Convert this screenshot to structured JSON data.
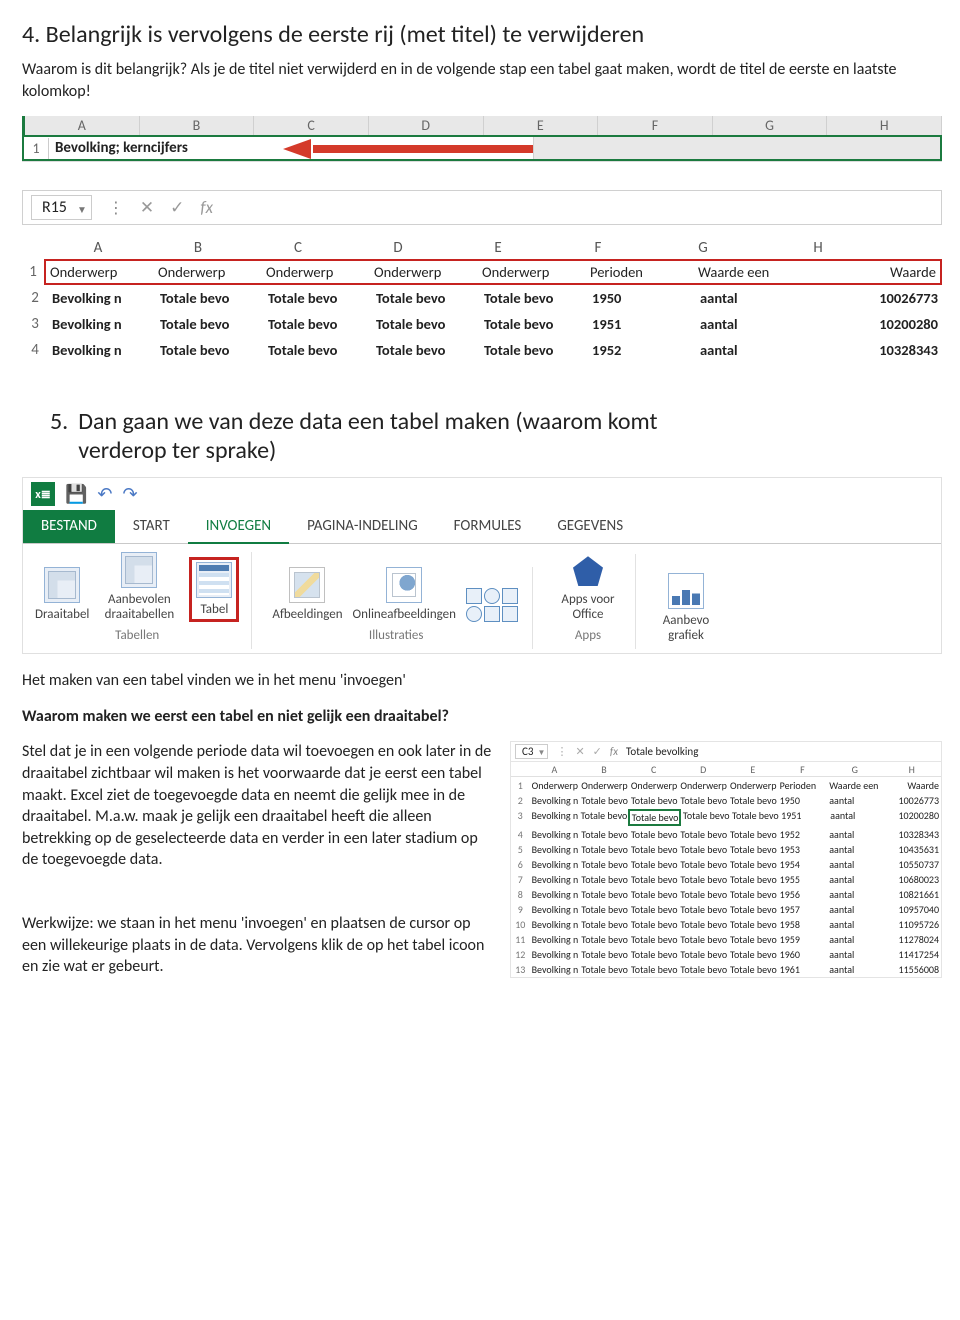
{
  "heading4": "4. Belangrijk is vervolgens de eerste rij (met titel) te verwijderen",
  "para4": "Waarom is dit belangrijk? Als je de titel niet verwijderd en in de volgende stap een tabel gaat maken, wordt de titel de eerste en laatste kolomkop!",
  "shot1": {
    "cols": [
      "A",
      "B",
      "C",
      "D",
      "E",
      "F",
      "G",
      "H"
    ],
    "rownum": "1",
    "celltext": "Bevolking; kerncijfers"
  },
  "shot2": {
    "namebox": "R15",
    "fx": "fx",
    "cols": [
      "A",
      "B",
      "C",
      "D",
      "E",
      "F",
      "G",
      "H"
    ],
    "widths": [
      100,
      100,
      100,
      100,
      100,
      100,
      110,
      120
    ],
    "rows": [
      {
        "n": "1",
        "bold": false,
        "cells": [
          "Onderwerp",
          "Onderwerp",
          "Onderwerp",
          "Onderwerp",
          "Onderwerp",
          "Perioden",
          "Waarde een",
          "Waarde"
        ]
      },
      {
        "n": "2",
        "bold": true,
        "cells": [
          "Bevolking n",
          "Totale bevo",
          "Totale bevo",
          "Totale bevo",
          "Totale bevo",
          "1950",
          "aantal",
          "10026773"
        ]
      },
      {
        "n": "3",
        "bold": true,
        "cells": [
          "Bevolking n",
          "Totale bevo",
          "Totale bevo",
          "Totale bevo",
          "Totale bevo",
          "1951",
          "aantal",
          "10200280"
        ]
      },
      {
        "n": "4",
        "bold": true,
        "cells": [
          "Bevolking n",
          "Totale bevo",
          "Totale bevo",
          "Totale bevo",
          "Totale bevo",
          "1952",
          "aantal",
          "10328343"
        ]
      }
    ]
  },
  "heading5_num": "5.",
  "heading5": "Dan gaan we van deze data een tabel maken (waarom komt verderop ter sprake)",
  "ribbon": {
    "tabs": [
      "BESTAND",
      "START",
      "INVOEGEN",
      "PAGINA-INDELING",
      "FORMULES",
      "GEGEVENS"
    ],
    "active": "INVOEGEN",
    "groups": {
      "tabellen": {
        "label": "Tabellen",
        "buttons": [
          "Draaitabel",
          "Aanbevolen draaitabellen",
          "Tabel"
        ]
      },
      "illustraties": {
        "label": "Illustraties",
        "buttons": [
          "Afbeeldingen",
          "Onlineafbeeldingen"
        ]
      },
      "apps": {
        "label": "Apps",
        "buttons": [
          "Apps voor Office",
          "Aanbevo grafiek"
        ]
      }
    }
  },
  "para5a": "Het maken van een tabel vinden we in het menu 'invoegen'",
  "para5b": "Waarom maken we eerst een tabel en niet gelijk een draaitabel?",
  "para5c_a": "Stel dat je in een volgende periode data wil toevoegen en ook later in de draaitabel zichtbaar wil maken is het voorwaarde dat je eerst een tabel maakt. Excel ziet de toegevoegde data en neemt die gelijk mee in de draaitabel. M.a.w. maak je gelijk een draaitabel heeft die alleen betrekking op de geselecteerde data en verder in een later stadium op de toegevoegde data.",
  "para5d": "Werkwijze: we staan in het menu 'invoegen' en plaatsen de cursor op een willekeurige plaats in de data. Vervolgens klik de op het tabel icoon en zie wat er gebeurt.",
  "minitable": {
    "namebox": "C3",
    "fx": "fx",
    "fval": "Totale bevolking",
    "cols": [
      "",
      "A",
      "B",
      "C",
      "D",
      "E",
      "F",
      "G",
      "H"
    ],
    "widths": [
      16,
      50,
      50,
      50,
      50,
      50,
      50,
      56,
      60
    ],
    "rows": [
      {
        "n": "1",
        "cells": [
          "Onderwerp",
          "Onderwerp",
          "Onderwerp",
          "Onderwerp",
          "Onderwerp",
          "Perioden",
          "Waarde een",
          "Waarde"
        ]
      },
      {
        "n": "2",
        "cells": [
          "Bevolking n",
          "Totale bevo",
          "Totale bevo",
          "Totale bevo",
          "Totale bevo",
          "1950",
          "aantal",
          "10026773"
        ]
      },
      {
        "n": "3",
        "cells": [
          "Bevolking n",
          "Totale bevo",
          "Totale bevo",
          "Totale bevo",
          "Totale bevo",
          "1951",
          "aantal",
          "10200280"
        ],
        "sel": 2
      },
      {
        "n": "4",
        "cells": [
          "Bevolking n",
          "Totale bevo",
          "Totale bevo",
          "Totale bevo",
          "Totale bevo",
          "1952",
          "aantal",
          "10328343"
        ]
      },
      {
        "n": "5",
        "cells": [
          "Bevolking n",
          "Totale bevo",
          "Totale bevo",
          "Totale bevo",
          "Totale bevo",
          "1953",
          "aantal",
          "10435631"
        ]
      },
      {
        "n": "6",
        "cells": [
          "Bevolking n",
          "Totale bevo",
          "Totale bevo",
          "Totale bevo",
          "Totale bevo",
          "1954",
          "aantal",
          "10550737"
        ]
      },
      {
        "n": "7",
        "cells": [
          "Bevolking n",
          "Totale bevo",
          "Totale bevo",
          "Totale bevo",
          "Totale bevo",
          "1955",
          "aantal",
          "10680023"
        ]
      },
      {
        "n": "8",
        "cells": [
          "Bevolking n",
          "Totale bevo",
          "Totale bevo",
          "Totale bevo",
          "Totale bevo",
          "1956",
          "aantal",
          "10821661"
        ]
      },
      {
        "n": "9",
        "cells": [
          "Bevolking n",
          "Totale bevo",
          "Totale bevo",
          "Totale bevo",
          "Totale bevo",
          "1957",
          "aantal",
          "10957040"
        ]
      },
      {
        "n": "10",
        "cells": [
          "Bevolking n",
          "Totale bevo",
          "Totale bevo",
          "Totale bevo",
          "Totale bevo",
          "1958",
          "aantal",
          "11095726"
        ]
      },
      {
        "n": "11",
        "cells": [
          "Bevolking n",
          "Totale bevo",
          "Totale bevo",
          "Totale bevo",
          "Totale bevo",
          "1959",
          "aantal",
          "11278024"
        ]
      },
      {
        "n": "12",
        "cells": [
          "Bevolking n",
          "Totale bevo",
          "Totale bevo",
          "Totale bevo",
          "Totale bevo",
          "1960",
          "aantal",
          "11417254"
        ]
      },
      {
        "n": "13",
        "cells": [
          "Bevolking n",
          "Totale bevo",
          "Totale bevo",
          "Totale bevo",
          "Totale bevo",
          "1961",
          "aantal",
          "11556008"
        ]
      }
    ]
  }
}
